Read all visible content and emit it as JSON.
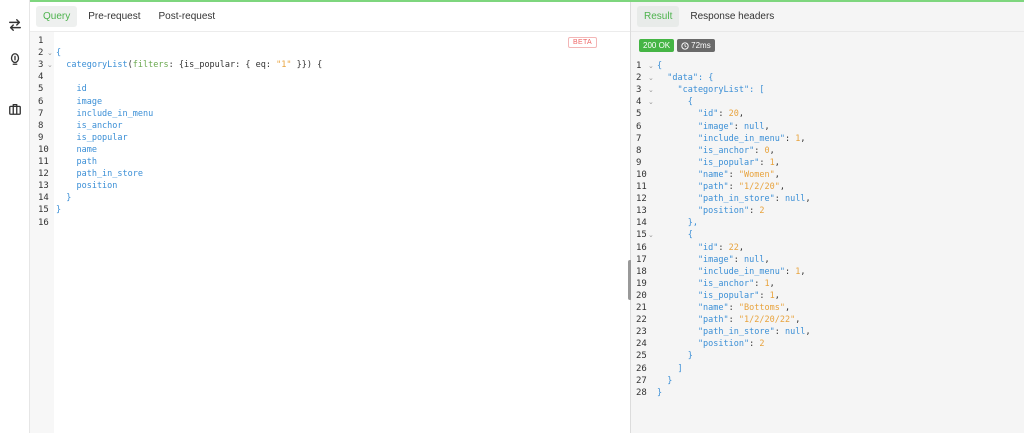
{
  "sidebar": {
    "icons": [
      "swap-icon",
      "bulb-icon",
      "briefcase-icon"
    ]
  },
  "query_panel": {
    "tabs": [
      "Query",
      "Pre-request",
      "Post-request"
    ],
    "beta_badge": "BETA",
    "lines": [
      {
        "n": "1",
        "fold": false,
        "tokens": []
      },
      {
        "n": "2",
        "fold": true,
        "tokens": [
          {
            "t": "{",
            "c": "c-brace"
          }
        ]
      },
      {
        "n": "3",
        "fold": true,
        "tokens": [
          {
            "t": "  categoryList",
            "c": "c-field"
          },
          {
            "t": "(",
            "c": "c-plain"
          },
          {
            "t": "filters",
            "c": "c-arg"
          },
          {
            "t": ": {",
            "c": "c-plain"
          },
          {
            "t": "is_popular",
            "c": "c-plain"
          },
          {
            "t": ": { ",
            "c": "c-plain"
          },
          {
            "t": "eq",
            "c": "c-plain"
          },
          {
            "t": ": ",
            "c": "c-plain"
          },
          {
            "t": "\"1\"",
            "c": "c-str"
          },
          {
            "t": " }}) {",
            "c": "c-plain"
          }
        ]
      },
      {
        "n": "4",
        "fold": false,
        "tokens": []
      },
      {
        "n": "5",
        "fold": false,
        "tokens": [
          {
            "t": "    id",
            "c": "c-field"
          }
        ]
      },
      {
        "n": "6",
        "fold": false,
        "tokens": [
          {
            "t": "    image",
            "c": "c-field"
          }
        ]
      },
      {
        "n": "7",
        "fold": false,
        "tokens": [
          {
            "t": "    include_in_menu",
            "c": "c-field"
          }
        ]
      },
      {
        "n": "8",
        "fold": false,
        "tokens": [
          {
            "t": "    is_anchor",
            "c": "c-field"
          }
        ]
      },
      {
        "n": "9",
        "fold": false,
        "tokens": [
          {
            "t": "    is_popular",
            "c": "c-field"
          }
        ]
      },
      {
        "n": "10",
        "fold": false,
        "tokens": [
          {
            "t": "    name",
            "c": "c-field"
          }
        ]
      },
      {
        "n": "11",
        "fold": false,
        "tokens": [
          {
            "t": "    path",
            "c": "c-field"
          }
        ]
      },
      {
        "n": "12",
        "fold": false,
        "tokens": [
          {
            "t": "    path_in_store",
            "c": "c-field"
          }
        ]
      },
      {
        "n": "13",
        "fold": false,
        "tokens": [
          {
            "t": "    position",
            "c": "c-field"
          }
        ]
      },
      {
        "n": "14",
        "fold": false,
        "tokens": [
          {
            "t": "  }",
            "c": "c-brace"
          }
        ]
      },
      {
        "n": "15",
        "fold": false,
        "tokens": [
          {
            "t": "}",
            "c": "c-brace"
          }
        ]
      },
      {
        "n": "16",
        "fold": false,
        "tokens": []
      }
    ]
  },
  "result_panel": {
    "tabs": [
      "Result",
      "Response headers"
    ],
    "status": "200 OK",
    "time": "72ms",
    "lines": [
      {
        "n": "1",
        "fold": true,
        "tokens": [
          {
            "t": "{",
            "c": "c-brace"
          }
        ]
      },
      {
        "n": "2",
        "fold": true,
        "tokens": [
          {
            "t": "  \"data\"",
            "c": "c-key"
          },
          {
            "t": ": {",
            "c": "c-brace"
          }
        ]
      },
      {
        "n": "3",
        "fold": true,
        "tokens": [
          {
            "t": "    \"categoryList\"",
            "c": "c-key"
          },
          {
            "t": ": [",
            "c": "c-brace"
          }
        ]
      },
      {
        "n": "4",
        "fold": true,
        "tokens": [
          {
            "t": "      {",
            "c": "c-brace"
          }
        ]
      },
      {
        "n": "5",
        "fold": false,
        "tokens": [
          {
            "t": "        \"id\"",
            "c": "c-key"
          },
          {
            "t": ": ",
            "c": "c-plain"
          },
          {
            "t": "20",
            "c": "c-num"
          },
          {
            "t": ",",
            "c": "c-plain"
          }
        ]
      },
      {
        "n": "6",
        "fold": false,
        "tokens": [
          {
            "t": "        \"image\"",
            "c": "c-key"
          },
          {
            "t": ": ",
            "c": "c-plain"
          },
          {
            "t": "null",
            "c": "c-null"
          },
          {
            "t": ",",
            "c": "c-plain"
          }
        ]
      },
      {
        "n": "7",
        "fold": false,
        "tokens": [
          {
            "t": "        \"include_in_menu\"",
            "c": "c-key"
          },
          {
            "t": ": ",
            "c": "c-plain"
          },
          {
            "t": "1",
            "c": "c-num"
          },
          {
            "t": ",",
            "c": "c-plain"
          }
        ]
      },
      {
        "n": "8",
        "fold": false,
        "tokens": [
          {
            "t": "        \"is_anchor\"",
            "c": "c-key"
          },
          {
            "t": ": ",
            "c": "c-plain"
          },
          {
            "t": "0",
            "c": "c-num"
          },
          {
            "t": ",",
            "c": "c-plain"
          }
        ]
      },
      {
        "n": "9",
        "fold": false,
        "tokens": [
          {
            "t": "        \"is_popular\"",
            "c": "c-key"
          },
          {
            "t": ": ",
            "c": "c-plain"
          },
          {
            "t": "1",
            "c": "c-num"
          },
          {
            "t": ",",
            "c": "c-plain"
          }
        ]
      },
      {
        "n": "10",
        "fold": false,
        "tokens": [
          {
            "t": "        \"name\"",
            "c": "c-key"
          },
          {
            "t": ": ",
            "c": "c-plain"
          },
          {
            "t": "\"Women\"",
            "c": "c-str"
          },
          {
            "t": ",",
            "c": "c-plain"
          }
        ]
      },
      {
        "n": "11",
        "fold": false,
        "tokens": [
          {
            "t": "        \"path\"",
            "c": "c-key"
          },
          {
            "t": ": ",
            "c": "c-plain"
          },
          {
            "t": "\"1/2/20\"",
            "c": "c-str"
          },
          {
            "t": ",",
            "c": "c-plain"
          }
        ]
      },
      {
        "n": "12",
        "fold": false,
        "tokens": [
          {
            "t": "        \"path_in_store\"",
            "c": "c-key"
          },
          {
            "t": ": ",
            "c": "c-plain"
          },
          {
            "t": "null",
            "c": "c-null"
          },
          {
            "t": ",",
            "c": "c-plain"
          }
        ]
      },
      {
        "n": "13",
        "fold": false,
        "tokens": [
          {
            "t": "        \"position\"",
            "c": "c-key"
          },
          {
            "t": ": ",
            "c": "c-plain"
          },
          {
            "t": "2",
            "c": "c-num"
          }
        ]
      },
      {
        "n": "14",
        "fold": false,
        "tokens": [
          {
            "t": "      },",
            "c": "c-brace"
          }
        ]
      },
      {
        "n": "15",
        "fold": true,
        "tokens": [
          {
            "t": "      {",
            "c": "c-brace"
          }
        ]
      },
      {
        "n": "16",
        "fold": false,
        "tokens": [
          {
            "t": "        \"id\"",
            "c": "c-key"
          },
          {
            "t": ": ",
            "c": "c-plain"
          },
          {
            "t": "22",
            "c": "c-num"
          },
          {
            "t": ",",
            "c": "c-plain"
          }
        ]
      },
      {
        "n": "17",
        "fold": false,
        "tokens": [
          {
            "t": "        \"image\"",
            "c": "c-key"
          },
          {
            "t": ": ",
            "c": "c-plain"
          },
          {
            "t": "null",
            "c": "c-null"
          },
          {
            "t": ",",
            "c": "c-plain"
          }
        ]
      },
      {
        "n": "18",
        "fold": false,
        "tokens": [
          {
            "t": "        \"include_in_menu\"",
            "c": "c-key"
          },
          {
            "t": ": ",
            "c": "c-plain"
          },
          {
            "t": "1",
            "c": "c-num"
          },
          {
            "t": ",",
            "c": "c-plain"
          }
        ]
      },
      {
        "n": "19",
        "fold": false,
        "tokens": [
          {
            "t": "        \"is_anchor\"",
            "c": "c-key"
          },
          {
            "t": ": ",
            "c": "c-plain"
          },
          {
            "t": "1",
            "c": "c-num"
          },
          {
            "t": ",",
            "c": "c-plain"
          }
        ]
      },
      {
        "n": "20",
        "fold": false,
        "tokens": [
          {
            "t": "        \"is_popular\"",
            "c": "c-key"
          },
          {
            "t": ": ",
            "c": "c-plain"
          },
          {
            "t": "1",
            "c": "c-num"
          },
          {
            "t": ",",
            "c": "c-plain"
          }
        ]
      },
      {
        "n": "21",
        "fold": false,
        "tokens": [
          {
            "t": "        \"name\"",
            "c": "c-key"
          },
          {
            "t": ": ",
            "c": "c-plain"
          },
          {
            "t": "\"Bottoms\"",
            "c": "c-str"
          },
          {
            "t": ",",
            "c": "c-plain"
          }
        ]
      },
      {
        "n": "22",
        "fold": false,
        "tokens": [
          {
            "t": "        \"path\"",
            "c": "c-key"
          },
          {
            "t": ": ",
            "c": "c-plain"
          },
          {
            "t": "\"1/2/20/22\"",
            "c": "c-str"
          },
          {
            "t": ",",
            "c": "c-plain"
          }
        ]
      },
      {
        "n": "23",
        "fold": false,
        "tokens": [
          {
            "t": "        \"path_in_store\"",
            "c": "c-key"
          },
          {
            "t": ": ",
            "c": "c-plain"
          },
          {
            "t": "null",
            "c": "c-null"
          },
          {
            "t": ",",
            "c": "c-plain"
          }
        ]
      },
      {
        "n": "24",
        "fold": false,
        "tokens": [
          {
            "t": "        \"position\"",
            "c": "c-key"
          },
          {
            "t": ": ",
            "c": "c-plain"
          },
          {
            "t": "2",
            "c": "c-num"
          }
        ]
      },
      {
        "n": "25",
        "fold": false,
        "tokens": [
          {
            "t": "      }",
            "c": "c-brace"
          }
        ]
      },
      {
        "n": "26",
        "fold": false,
        "tokens": [
          {
            "t": "    ]",
            "c": "c-brace"
          }
        ]
      },
      {
        "n": "27",
        "fold": false,
        "tokens": [
          {
            "t": "  }",
            "c": "c-brace"
          }
        ]
      },
      {
        "n": "28",
        "fold": false,
        "tokens": [
          {
            "t": "}",
            "c": "c-brace"
          }
        ]
      }
    ]
  }
}
